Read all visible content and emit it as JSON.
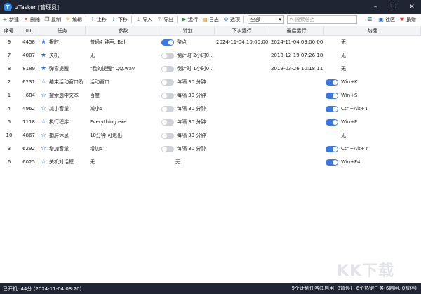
{
  "window": {
    "title": "zTasker [管理员]"
  },
  "toolbar": {
    "left": [
      {
        "name": "new-button",
        "icon": "+",
        "color": "#2e8b3d",
        "label": "新建"
      },
      {
        "name": "delete-button",
        "icon": "✕",
        "color": "#d23b3b",
        "label": "删除"
      },
      {
        "name": "copy-button",
        "icon": "❐",
        "color": "#555555",
        "label": "复制"
      },
      {
        "name": "edit-button",
        "icon": "✎",
        "color": "#c98a1a",
        "label": "编辑"
      },
      {
        "name": "move-up-button",
        "icon": "↑",
        "color": "#2a6fd6",
        "label": "上移"
      },
      {
        "name": "move-down-button",
        "icon": "↓",
        "color": "#2a6fd6",
        "label": "下移"
      },
      {
        "name": "import-button",
        "icon": "⤓",
        "color": "#555555",
        "label": "导入"
      },
      {
        "name": "export-button",
        "icon": "⤒",
        "color": "#555555",
        "label": "导出"
      },
      {
        "name": "run-button",
        "icon": "▶",
        "color": "#2e8b3d",
        "label": "运行"
      },
      {
        "name": "log-button",
        "icon": "▤",
        "color": "#c98a1a",
        "label": "日志"
      },
      {
        "name": "options-button",
        "icon": "⚙",
        "color": "#2a6fd6",
        "label": "选项"
      }
    ],
    "filter_value": "全部",
    "search_placeholder": "搜索任务",
    "right": [
      {
        "name": "list-view-button",
        "icon": "☰",
        "color": "#2a6fd6",
        "label": ""
      },
      {
        "name": "community-button",
        "icon": "▣",
        "color": "#2a6fd6",
        "label": "社区"
      },
      {
        "name": "donate-button",
        "icon": "♥",
        "color": "#d23b3b",
        "label": "捐赠"
      }
    ]
  },
  "columns": [
    "序号",
    "ID",
    "任务",
    "参数",
    "计划",
    "下次运行",
    "最后运行",
    "热键"
  ],
  "rows": [
    {
      "no": "9",
      "id": "4458",
      "starred": true,
      "task": "报时",
      "param": "普通4 钟声: Bell",
      "plan_on": true,
      "plan": "整点",
      "next": "2024-11-04 10:00:00",
      "last": "2024-11-04 09:00:00",
      "hotkey_on": false,
      "hotkey": "无"
    },
    {
      "no": "7",
      "id": "4007",
      "starred": true,
      "task": "关机",
      "param": "无",
      "plan_on": false,
      "plan": "倒计时 2小时0...",
      "next": "",
      "last": "2018-12-19 07:26:18",
      "hotkey_on": false,
      "hotkey": "无"
    },
    {
      "no": "8",
      "id": "8189",
      "starred": true,
      "task": "弹窗提醒",
      "param": "\"我的提醒\" QQ.wav",
      "plan_on": false,
      "plan": "倒计时 1小时0...",
      "next": "",
      "last": "2019-03-26 10:18:11",
      "hotkey_on": false,
      "hotkey": "无"
    },
    {
      "no": "2",
      "id": "6231",
      "starred": false,
      "task": "结束活动窗口及...",
      "param": "活动窗口",
      "plan_on": false,
      "plan": "每隔 30 分钟",
      "next": "",
      "last": "",
      "hotkey_on": true,
      "hotkey": "Win+K"
    },
    {
      "no": "1",
      "id": "684",
      "starred": false,
      "task": "搜索选中文本",
      "param": "百度",
      "plan_on": false,
      "plan": "每隔 30 分钟",
      "next": "",
      "last": "",
      "hotkey_on": true,
      "hotkey": "Win+S"
    },
    {
      "no": "4",
      "id": "4962",
      "starred": false,
      "task": "减小音量",
      "param": "减小5",
      "plan_on": false,
      "plan": "每隔 30 分钟",
      "next": "",
      "last": "",
      "hotkey_on": true,
      "hotkey": "Ctrl+Alt+↓"
    },
    {
      "no": "5",
      "id": "1118",
      "starred": false,
      "task": "执行程序",
      "param": "Everything.exe",
      "plan_on": false,
      "plan": "每隔 30 分钟",
      "next": "",
      "last": "",
      "hotkey_on": true,
      "hotkey": "Win+F"
    },
    {
      "no": "10",
      "id": "4867",
      "starred": false,
      "task": "指屏休息",
      "param": "10分钟 可退出",
      "plan_on": false,
      "plan": "每隔 30 分钟",
      "next": "",
      "last": "",
      "hotkey_on": false,
      "hotkey": "无"
    },
    {
      "no": "3",
      "id": "6292",
      "starred": false,
      "task": "增加音量",
      "param": "增加5",
      "plan_on": false,
      "plan": "每隔 30 分钟",
      "next": "",
      "last": "",
      "hotkey_on": true,
      "hotkey": "Ctrl+Alt+↑"
    },
    {
      "no": "6",
      "id": "6025",
      "starred": false,
      "task": "关机对话框",
      "param": "无",
      "plan_on": null,
      "plan": "无",
      "next": "",
      "last": "",
      "hotkey_on": true,
      "hotkey": "Win+F4"
    }
  ],
  "status": {
    "uptime": "已开机: 44分 (2024-11-04 08:20)",
    "plan_tasks": "9个计划任务(1启用, 8暂停)",
    "hotkey_tasks": "6个热键任务(6启用, 0暂停)"
  },
  "watermark": "KK下载",
  "colors": {
    "titlebar": "#1f2533",
    "accent": "#3a78e6",
    "star": "#2a6fd6"
  }
}
